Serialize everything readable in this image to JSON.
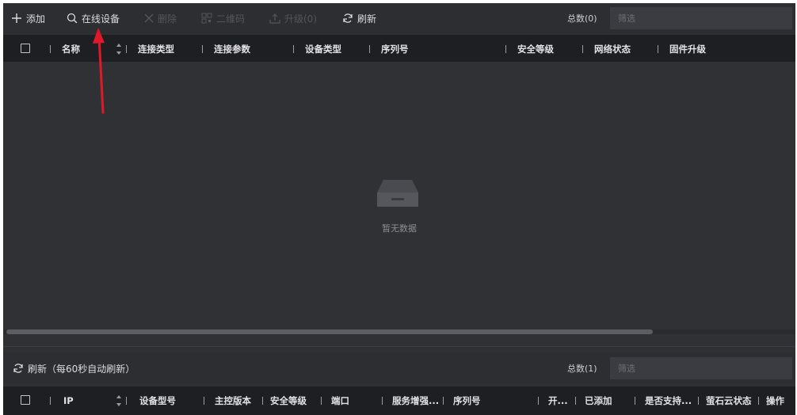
{
  "toolbar": {
    "add": "添加",
    "online_devices": "在线设备",
    "delete": "删除",
    "qrcode": "二维码",
    "upgrade": "升级(0)",
    "refresh": "刷新",
    "total": "总数(0)",
    "filter_placeholder": "筛选"
  },
  "device_table": {
    "headers": [
      "名称",
      "连接类型",
      "连接参数",
      "设备类型",
      "序列号",
      "安全等级",
      "网络状态",
      "固件升级"
    ],
    "empty_text": "暂无数据"
  },
  "online_section": {
    "refresh_label": "刷新（每60秒自动刷新）",
    "total": "总数(1)",
    "filter_placeholder": "筛选",
    "headers": [
      "IP",
      "设备型号",
      "主控版本",
      "安全等级",
      "端口",
      "服务增强...",
      "序列号",
      "开...",
      "已添加",
      "是否支持...",
      "萤石云状态",
      "操作"
    ]
  },
  "colors": {
    "background": "#2f3034",
    "header_bg": "#1e1f22",
    "annotation_arrow": "#e0192a"
  },
  "icons": [
    "plus-icon",
    "search-icon",
    "close-icon",
    "qrcode-icon",
    "upload-icon",
    "refresh-icon",
    "checkbox-icon",
    "sort-icon",
    "empty-box-icon",
    "arrow-annotation"
  ]
}
